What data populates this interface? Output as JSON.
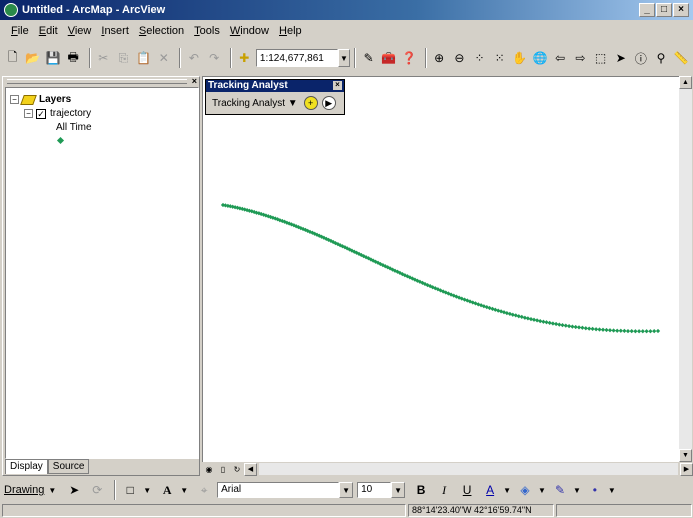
{
  "window": {
    "title": "Untitled - ArcMap - ArcView"
  },
  "menu": [
    "File",
    "Edit",
    "View",
    "Insert",
    "Selection",
    "Tools",
    "Window",
    "Help"
  ],
  "toolbar": {
    "scale": "1:124,677,861"
  },
  "toc": {
    "root_label": "Layers",
    "layer_label": "trajectory",
    "class_label": "All Time",
    "tabs": [
      "Display",
      "Source"
    ]
  },
  "tracking_analyst": {
    "title": "Tracking Analyst",
    "dropdown_label": "Tracking Analyst"
  },
  "drawing": {
    "label": "Drawing",
    "font": "Arial",
    "size": "10"
  },
  "status": {
    "coordinates": "88°14'23.40\"W  42°16'59.74\"N"
  },
  "colors": {
    "trajectory": "#1f9a55",
    "title_bar": "#0a246a"
  }
}
